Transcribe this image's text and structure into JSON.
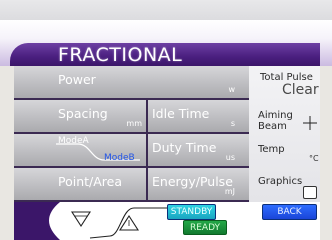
{
  "header": {
    "title": "FRACTIONAL"
  },
  "params": {
    "power": {
      "label": "Power",
      "unit": "w"
    },
    "spacing": {
      "label": "Spacing",
      "unit": "mm"
    },
    "mode": {
      "label_a": "ModeA",
      "label_b": "ModeB"
    },
    "point_area": {
      "label": "Point/Area"
    },
    "idle_time": {
      "label": "Idle Time",
      "unit": "s"
    },
    "duty_time": {
      "label": "Duty Time",
      "unit": "us"
    },
    "energy_pulse": {
      "label": "Energy/Pulse",
      "unit": "mJ"
    }
  },
  "side": {
    "total_pulse_label": "Total Pulse",
    "clear_label": "Clear",
    "aiming_beam_label_1": "Aiming",
    "aiming_beam_label_2": "Beam",
    "temp_label": "Temp",
    "temp_unit": "°C",
    "graphics_label": "Graphics"
  },
  "buttons": {
    "standby": "STANDBY",
    "ready": "READY",
    "back": "BACK"
  },
  "colors": {
    "accent_purple": "#4a1f7f",
    "standby": "#22bcd4",
    "ready": "#1a9a3c",
    "back": "#2255e8"
  }
}
